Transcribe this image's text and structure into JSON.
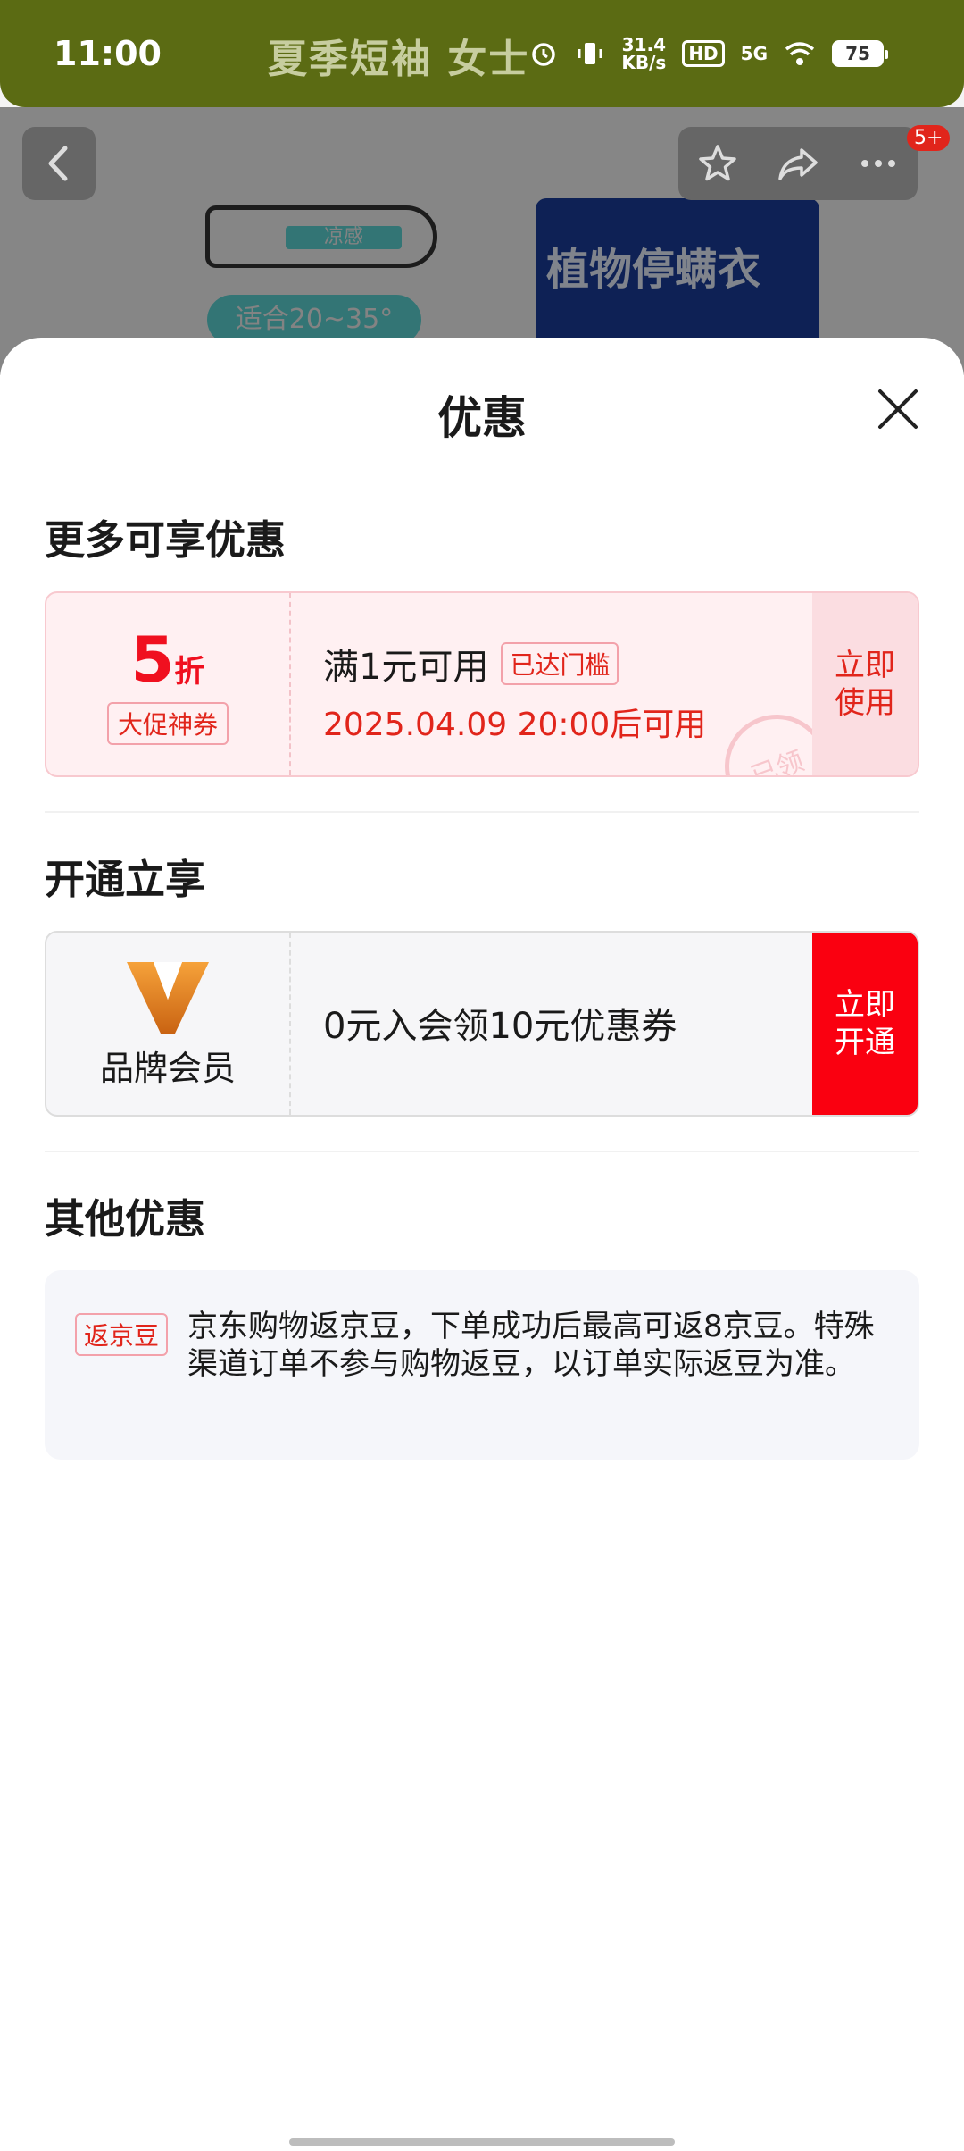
{
  "status_bar": {
    "time": "11:00",
    "speed_value": "31.4",
    "speed_unit": "KB/s",
    "hd": "HD",
    "network": "5G",
    "battery": "75"
  },
  "background_page": {
    "title": "夏季短袖 女士",
    "badge": "5+",
    "thermo_label": "凉感",
    "temp_label": "适合20~35°",
    "product_text": "植物停螨衣"
  },
  "sheet": {
    "title": "优惠",
    "section_more": "更多可享优惠",
    "section_membership": "开通立享",
    "section_other": "其他优惠"
  },
  "coupon_discount": {
    "number": "5",
    "unit": "折",
    "tag": "大促神券",
    "condition": "满1元可用",
    "threshold_tag": "已达门槛",
    "valid_time": "2025.04.09 20:00后可用",
    "stamp": "已领",
    "action_line1": "立即",
    "action_line2": "使用"
  },
  "coupon_member": {
    "label": "品牌会员",
    "desc": "0元入会领10元优惠券",
    "action_line1": "立即",
    "action_line2": "开通"
  },
  "other": {
    "tag": "返京豆",
    "text": "京东购物返京豆，下单成功后最高可返8京豆。特殊渠道订单不参与购物返豆，以订单实际返豆为准。"
  }
}
